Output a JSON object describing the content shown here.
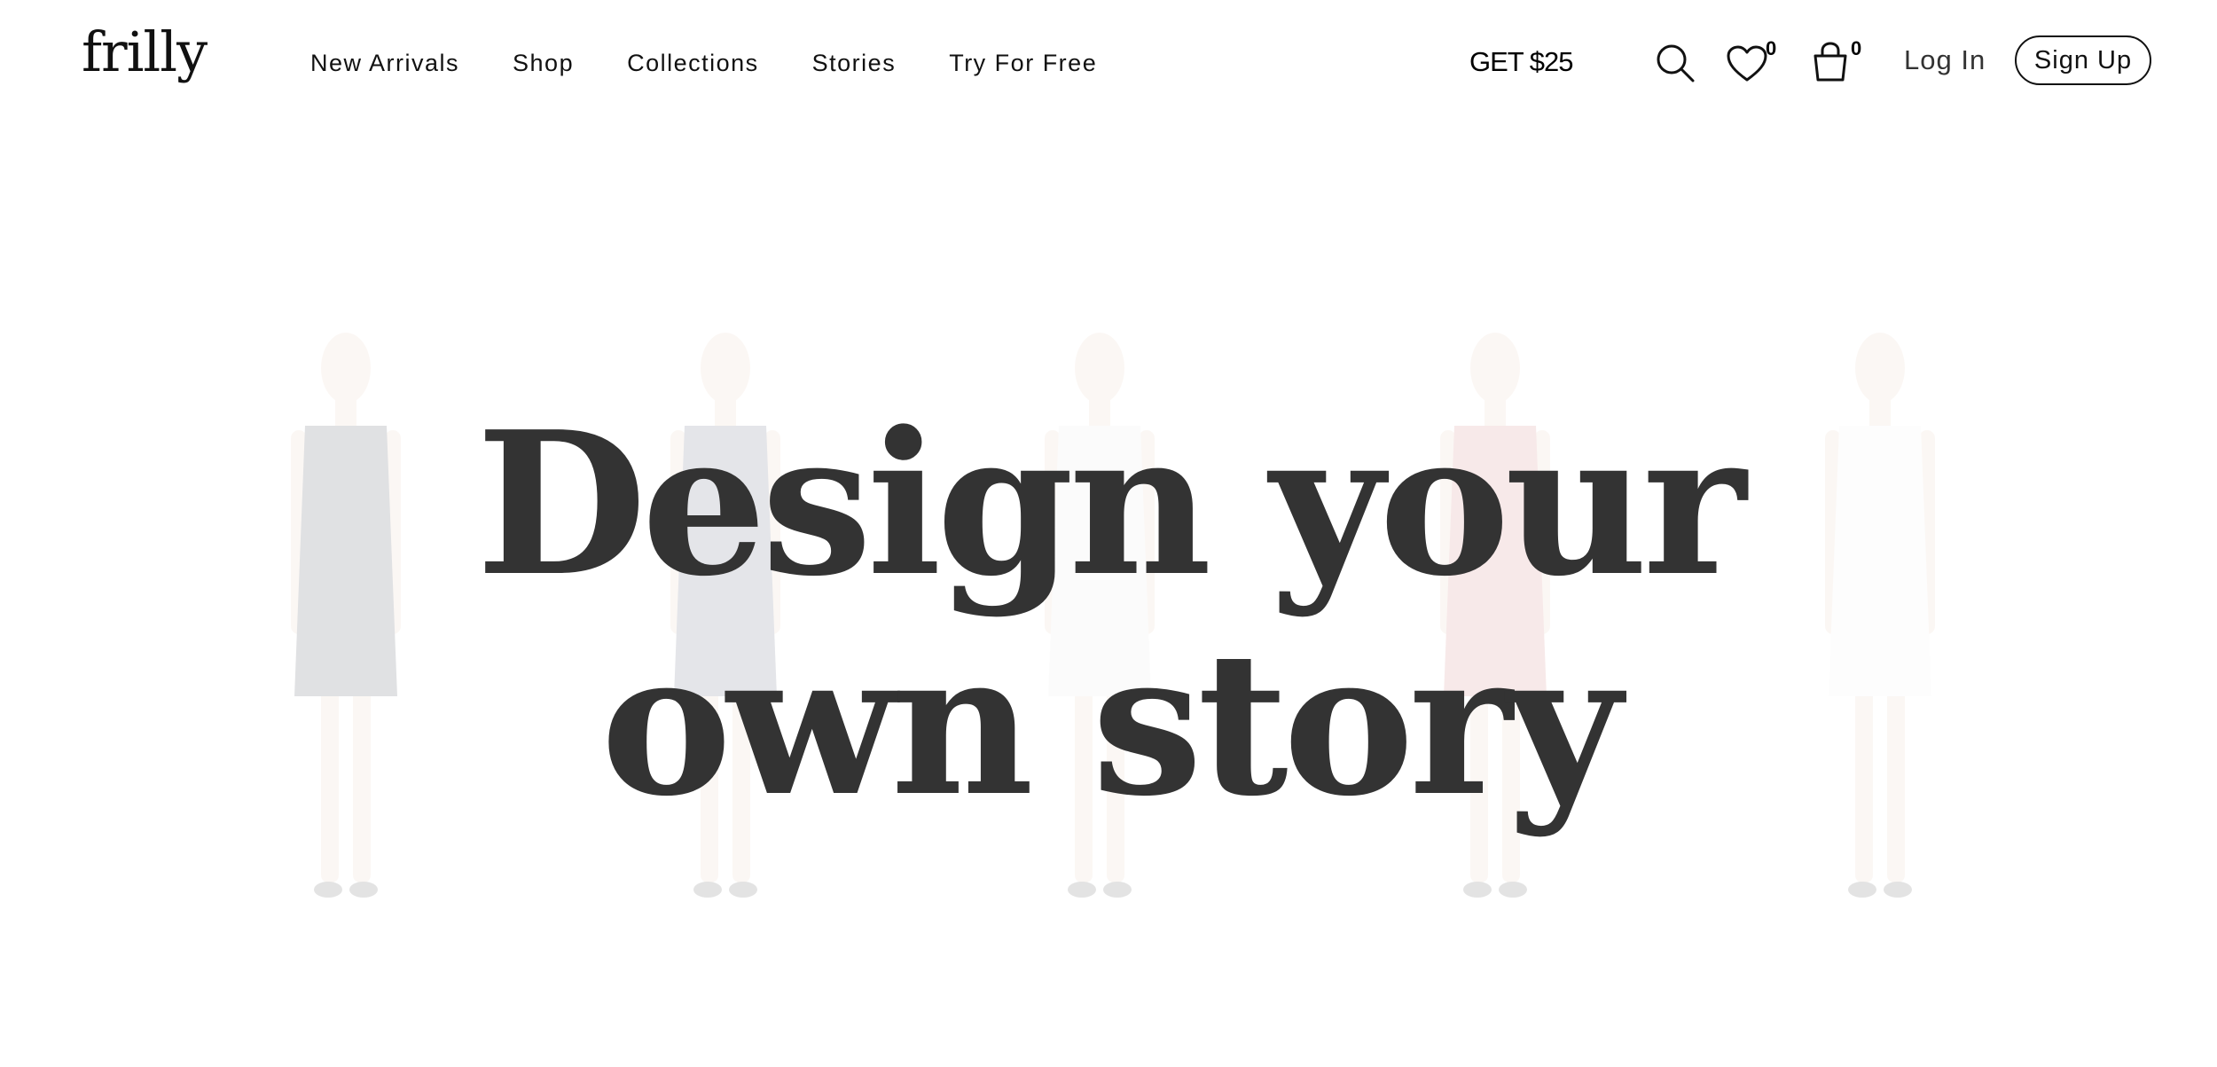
{
  "header": {
    "logo": "frilly",
    "nav": [
      "New Arrivals",
      "Shop",
      "Collections",
      "Stories",
      "Try For Free"
    ],
    "promo": "GET $25",
    "wishlist_count": "0",
    "cart_count": "0",
    "login": "Log In",
    "signup": "Sign Up",
    "icons": [
      "search-icon",
      "heart-icon",
      "shopping-bag-icon"
    ]
  },
  "hero": {
    "headline_line1": "Design your",
    "headline_line2": "own story",
    "model_dress_colors": [
      "#1c2230",
      "#34405a",
      "#e8e8e8",
      "#c9605a",
      "#f4f4f4"
    ]
  }
}
